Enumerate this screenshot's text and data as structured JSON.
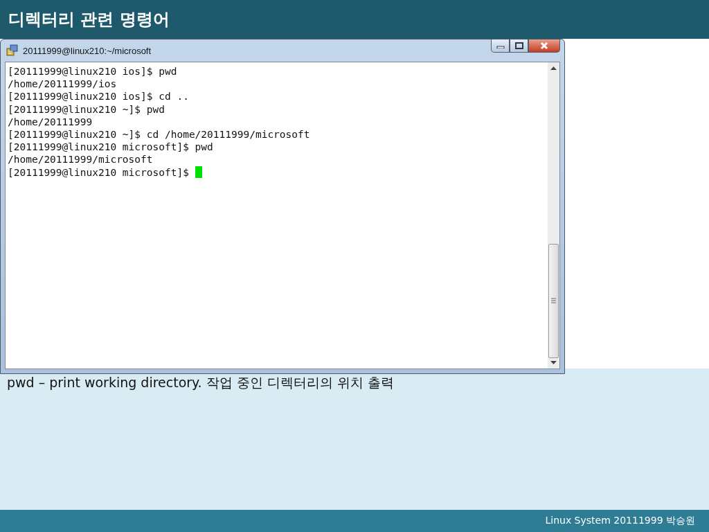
{
  "slide": {
    "title": "디렉터리 관련 명령어"
  },
  "window": {
    "title": "20111999@linux210:~/microsoft"
  },
  "terminal": {
    "lines": [
      "[20111999@linux210 ios]$ pwd",
      "/home/20111999/ios",
      "[20111999@linux210 ios]$ cd ..",
      "[20111999@linux210 ~]$ pwd",
      "/home/20111999",
      "[20111999@linux210 ~]$ cd /home/20111999/microsoft",
      "[20111999@linux210 microsoft]$ pwd",
      "/home/20111999/microsoft",
      "[20111999@linux210 microsoft]$ "
    ],
    "cursor": true
  },
  "caption": "pwd – print working directory. 작업 중인 디렉터리의 위치 출력",
  "footer": "Linux System 20111999 박승원"
}
